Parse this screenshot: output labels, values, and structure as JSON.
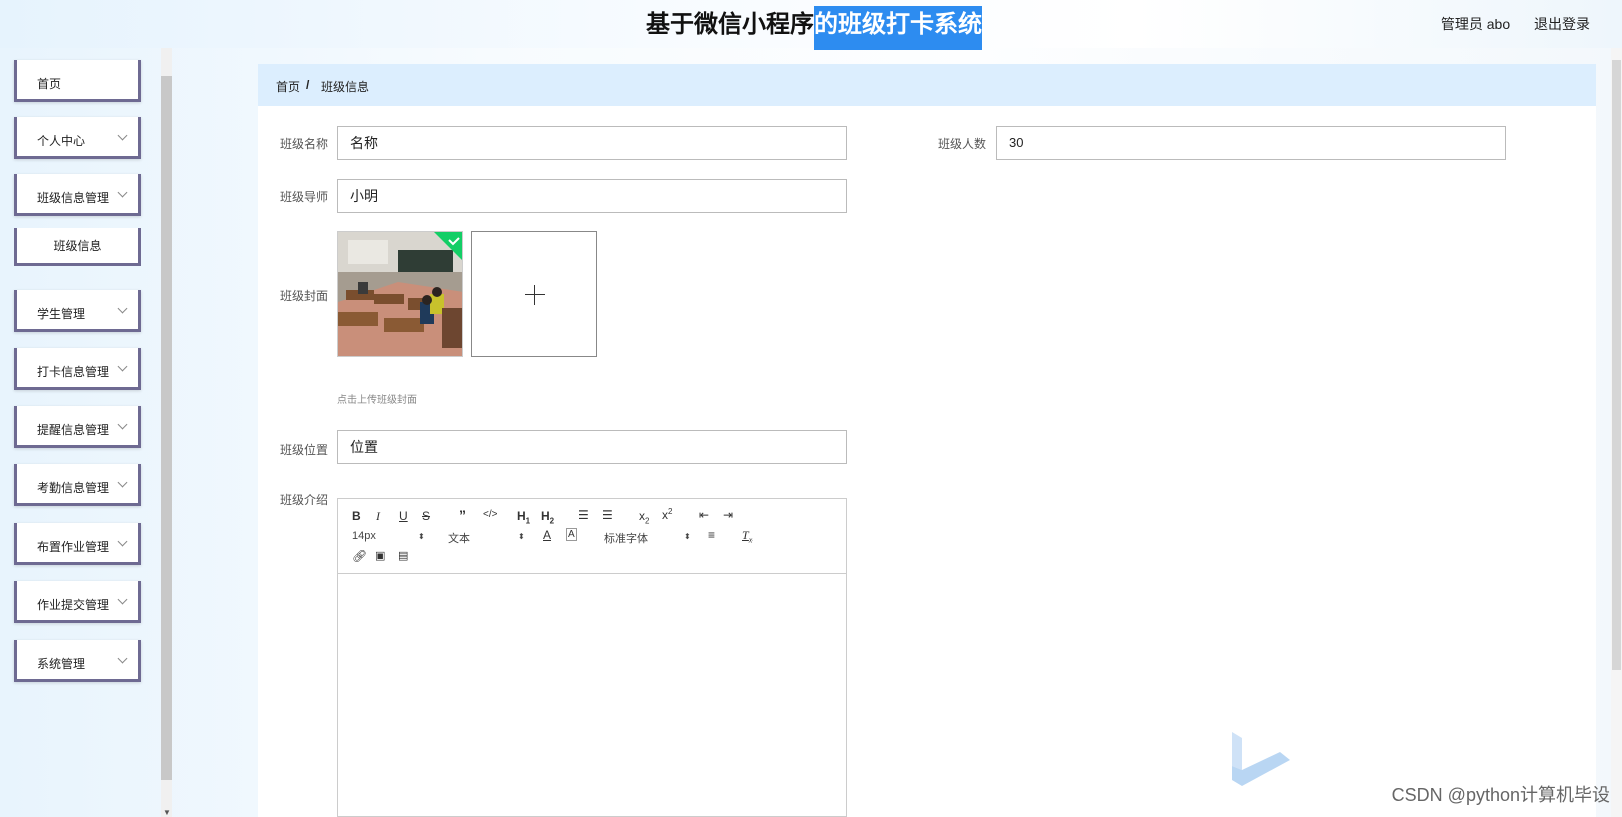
{
  "header": {
    "title_part1": "基于微信小程序",
    "title_part2": "的班级打卡系统",
    "admin_label": "管理员 abo",
    "logout_label": "退出登录"
  },
  "sidebar": {
    "items": [
      {
        "label": "首页",
        "expandable": false
      },
      {
        "label": "个人中心",
        "expandable": true
      },
      {
        "label": "班级信息管理",
        "expandable": true
      },
      {
        "label": "学生管理",
        "expandable": true
      },
      {
        "label": "打卡信息管理",
        "expandable": true
      },
      {
        "label": "提醒信息管理",
        "expandable": true
      },
      {
        "label": "考勤信息管理",
        "expandable": true
      },
      {
        "label": "布置作业管理",
        "expandable": true
      },
      {
        "label": "作业提交管理",
        "expandable": true
      },
      {
        "label": "系统管理",
        "expandable": true
      }
    ],
    "sub_item": "班级信息"
  },
  "breadcrumb": {
    "home": "首页",
    "separator": "/",
    "current": "班级信息"
  },
  "form": {
    "class_name_label": "班级名称",
    "class_name_value": "名称",
    "class_size_label": "班级人数",
    "class_size_value": "30",
    "teacher_label": "班级导师",
    "teacher_value": "小明",
    "cover_label": "班级封面",
    "cover_tip": "点击上传班级封面",
    "location_label": "班级位置",
    "location_value": "位置",
    "intro_label": "班级介绍"
  },
  "editor": {
    "font_size": "14px",
    "header_select": "文本",
    "font_family": "标准字体"
  },
  "watermark": "CSDN @python计算机毕设",
  "colors": {
    "accent": "#2d8cf0",
    "breadcrumb_bg": "#dceefe",
    "menu_border": "#6e6a92",
    "upload_ok": "#13ce66"
  }
}
